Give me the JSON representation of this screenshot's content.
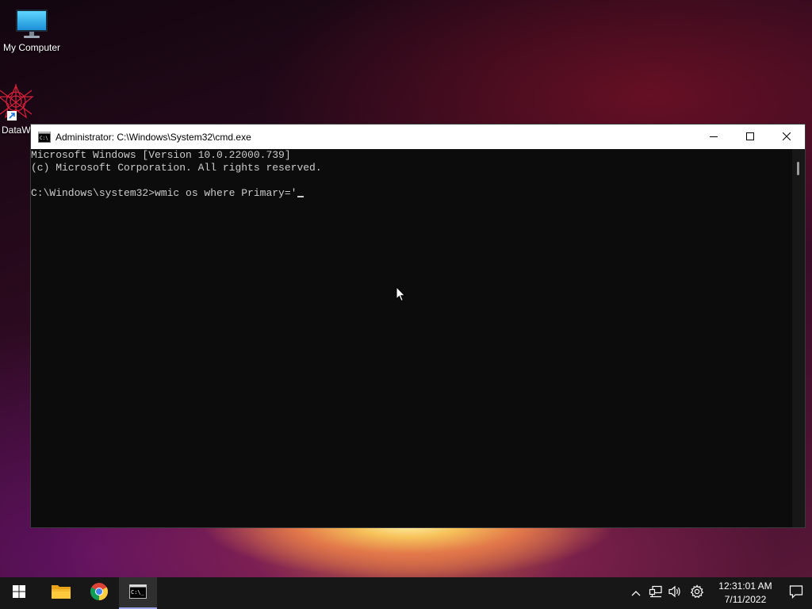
{
  "desktop": {
    "icons": [
      {
        "label": "My Computer",
        "icon": "monitor-icon"
      },
      {
        "label": "DataW",
        "icon": "datawarrior-shortcut-icon"
      }
    ]
  },
  "window": {
    "title": "Administrator: C:\\Windows\\System32\\cmd.exe",
    "console_lines": [
      "Microsoft Windows [Version 10.0.22000.739]",
      "(c) Microsoft Corporation. All rights reserved.",
      "",
      "C:\\Windows\\system32>wmic os where Primary='"
    ],
    "controls": [
      "minimize-icon",
      "maximize-icon",
      "close-icon"
    ]
  },
  "taskbar": {
    "buttons": [
      {
        "name": "start",
        "icon": "windows-logo-icon"
      },
      {
        "name": "file-explorer",
        "icon": "folder-icon"
      },
      {
        "name": "chrome",
        "icon": "chrome-icon"
      },
      {
        "name": "command-prompt",
        "icon": "cmd-icon",
        "active": true
      }
    ],
    "tray": [
      "chevron-up-icon",
      "network-icon",
      "volume-icon",
      "settings-gear-icon"
    ],
    "clock": {
      "time": "12:31:01 AM",
      "date": "7/11/2022"
    }
  },
  "colors": {
    "console_bg": "#0c0c0c",
    "console_text": "#cccccc",
    "taskbar_bg": "#171717",
    "active_indicator": "#9ea3e8"
  }
}
